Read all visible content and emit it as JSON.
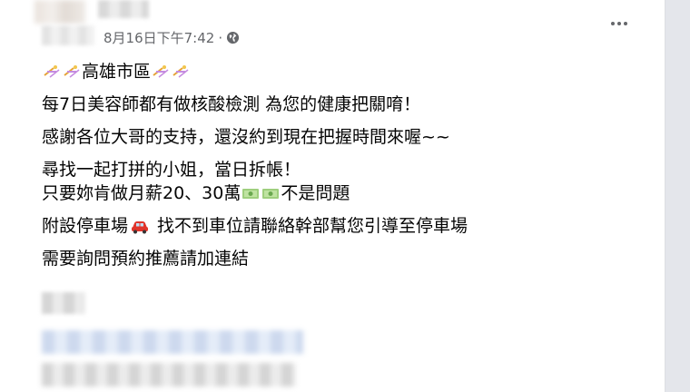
{
  "post": {
    "timestamp": "8月16日下午7:42",
    "separator": "·",
    "privacy_icon": "globe-icon",
    "more_icon": "more-horizontal-icon",
    "lines": {
      "location": "高雄市區",
      "covid_test": "每7日美容師都有做核酸檢測 為您的健康把關唷！",
      "thanks": "感謝各位大哥的支持，還沒約到現在把握時間來喔~~",
      "seeking": "尋找一起打拼的小姐，當日拆帳！",
      "salary_prefix": "只要妳肯做月薪20、30萬",
      "salary_suffix": "不是問題",
      "parking_prefix": "附設停車場",
      "parking_suffix": " 找不到車位請聯絡幹部幫您引導至停車場",
      "contact": "需要詢問預約推薦請加連結"
    },
    "emoji_names": {
      "sparkle": "sparkles-emoji",
      "money": "banknote-emoji",
      "car": "car-emoji"
    }
  }
}
